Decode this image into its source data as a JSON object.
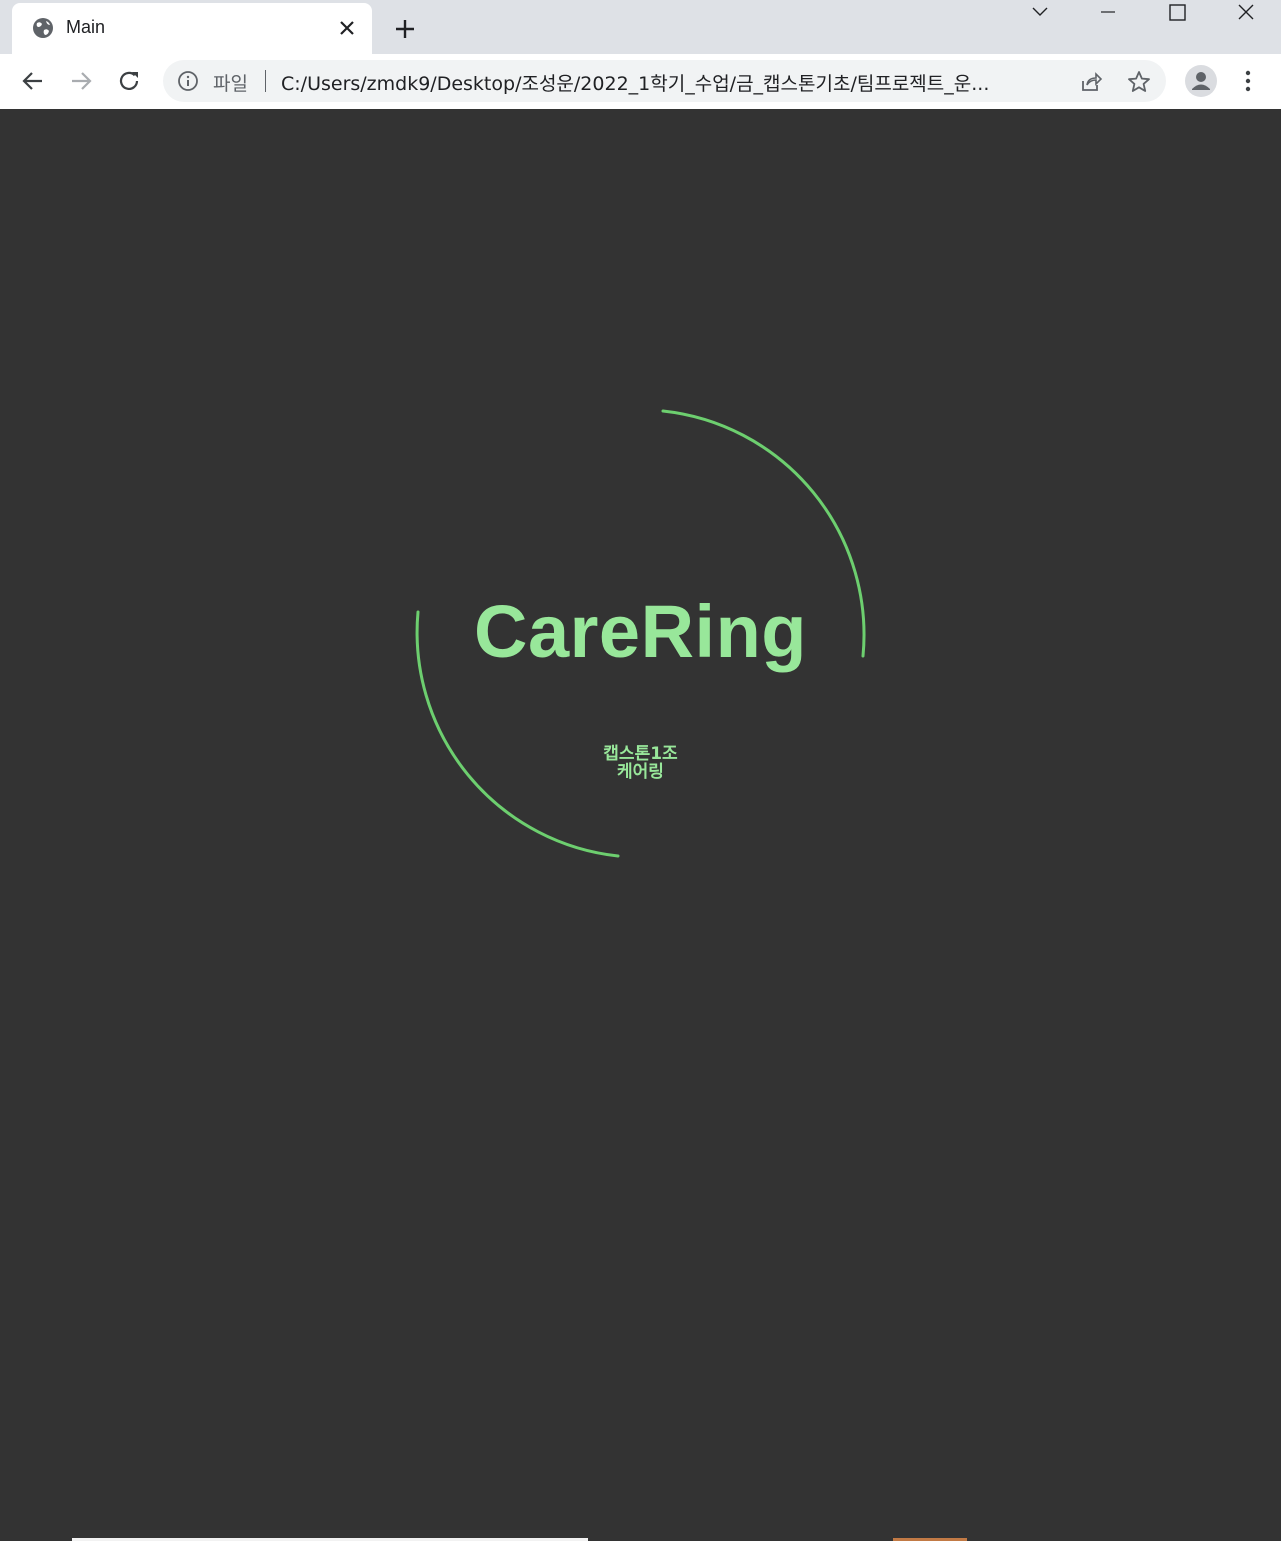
{
  "tab": {
    "title": "Main",
    "favicon": "globe-icon"
  },
  "omnibox": {
    "scheme_label": "파일",
    "url": "C:/Users/zmdk9/Desktop/조성운/2022_1학기_수업/금_캡스톤기초/팀프로젝트_운..."
  },
  "page": {
    "brand_title": "CareRing",
    "subtitle_line1": "캡스톤1조",
    "subtitle_line2": "케어링",
    "accent_color": "#98e79a",
    "ring_color": "#6dcf6f",
    "background_color": "#333333"
  }
}
